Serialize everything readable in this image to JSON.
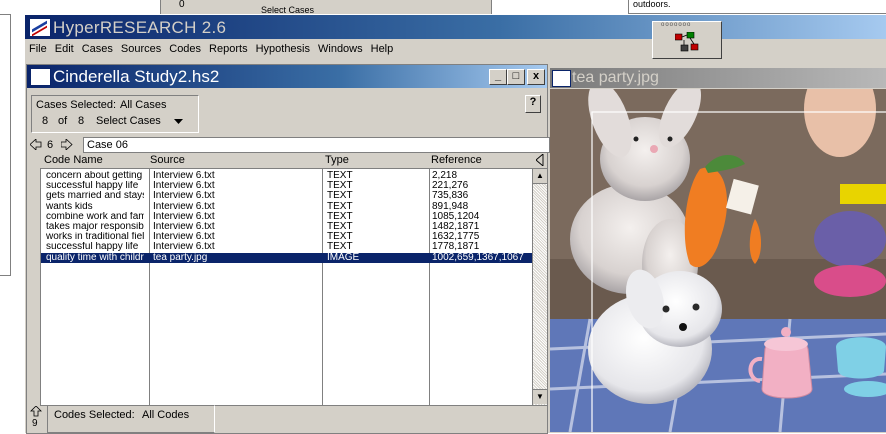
{
  "background": {
    "window_fragment_text": "outdoors.",
    "num_cell": "0",
    "cut_text": "Select Cases"
  },
  "app": {
    "title": "HyperRESEARCH 2.6",
    "menu": [
      "File",
      "Edit",
      "Cases",
      "Sources",
      "Codes",
      "Reports",
      "Hypothesis",
      "Windows",
      "Help"
    ]
  },
  "doc_window": {
    "title": "Cinderella Study2.hs2",
    "minimize": "_",
    "maximize": "□",
    "close": "x",
    "help": "?",
    "cases_selected_label": "Cases Selected:",
    "cases_selected_value": "All Cases",
    "case_index": "8",
    "case_of": "of",
    "case_total": "8",
    "select_cases_label": "Select Cases",
    "nav_number": "6",
    "case_name": "Case 06",
    "columns": [
      "Code Name",
      "Source",
      "Type",
      "Reference"
    ],
    "rows": [
      {
        "code": "concern about getting",
        "source": "Interview 6.txt",
        "type": "TEXT",
        "ref": "2,218",
        "selected": false
      },
      {
        "code": "successful happy life",
        "source": "Interview 6.txt",
        "type": "TEXT",
        "ref": "221,276",
        "selected": false
      },
      {
        "code": "gets married and stays",
        "source": "Interview 6.txt",
        "type": "TEXT",
        "ref": "735,836",
        "selected": false
      },
      {
        "code": "wants kids",
        "source": "Interview 6.txt",
        "type": "TEXT",
        "ref": "891,948",
        "selected": false
      },
      {
        "code": "combine work and fam",
        "source": "Interview 6.txt",
        "type": "TEXT",
        "ref": "1085,1204",
        "selected": false
      },
      {
        "code": "takes major responsibil",
        "source": "Interview 6.txt",
        "type": "TEXT",
        "ref": "1482,1871",
        "selected": false
      },
      {
        "code": "works in traditional field",
        "source": "Interview 6.txt",
        "type": "TEXT",
        "ref": "1632,1775",
        "selected": false
      },
      {
        "code": "successful happy life",
        "source": "Interview 6.txt",
        "type": "TEXT",
        "ref": "1778,1871",
        "selected": false
      },
      {
        "code": "quality time with childre",
        "source": "tea party.jpg",
        "type": "IMAGE",
        "ref": "1002,659,1367,1067",
        "selected": true
      }
    ],
    "codes_index": "9",
    "codes_selected_label": "Codes Selected:",
    "codes_selected_value": "All Codes"
  },
  "image_window": {
    "title": "tea party.jpg"
  },
  "colors": {
    "title_active": "#0a246a",
    "title_inactive": "#808080",
    "face": "#d4d0c8",
    "selection": "#0a246a"
  }
}
